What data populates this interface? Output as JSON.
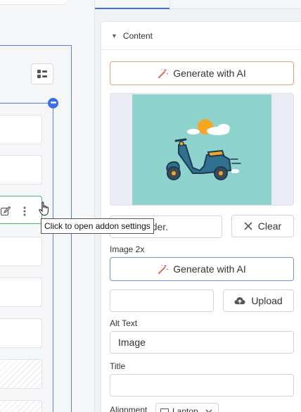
{
  "tooltip": {
    "text": "Click to open addon settings"
  },
  "panel": {
    "section_title": "Content",
    "generate_ai_label": "Generate with AI",
    "image_path_value": "sppagebuilder.",
    "clear_label": "Clear",
    "image2x_label": "Image 2x",
    "generate_ai_label_2": "Generate with AI",
    "image2x_value": "",
    "upload_label": "Upload",
    "alt_text_label": "Alt Text",
    "alt_text_value": "Image",
    "title_label": "Title",
    "title_value": "",
    "alignment_label": "Alignment",
    "alignment_value": "Laptop"
  },
  "colors": {
    "accent": "#3d6ee8",
    "ai_border": "#e7a17b",
    "active_field": "#4cb46b",
    "preview_bg": "#8fd3cf"
  },
  "icons": [
    "layout-icon",
    "options-dots-icon",
    "edit-icon",
    "more-vertical-icon",
    "pointer-cursor-icon",
    "caret-down-icon",
    "magic-wand-icon",
    "close-icon",
    "cloud-upload-icon",
    "monitor-icon",
    "chevron-down-icon"
  ]
}
